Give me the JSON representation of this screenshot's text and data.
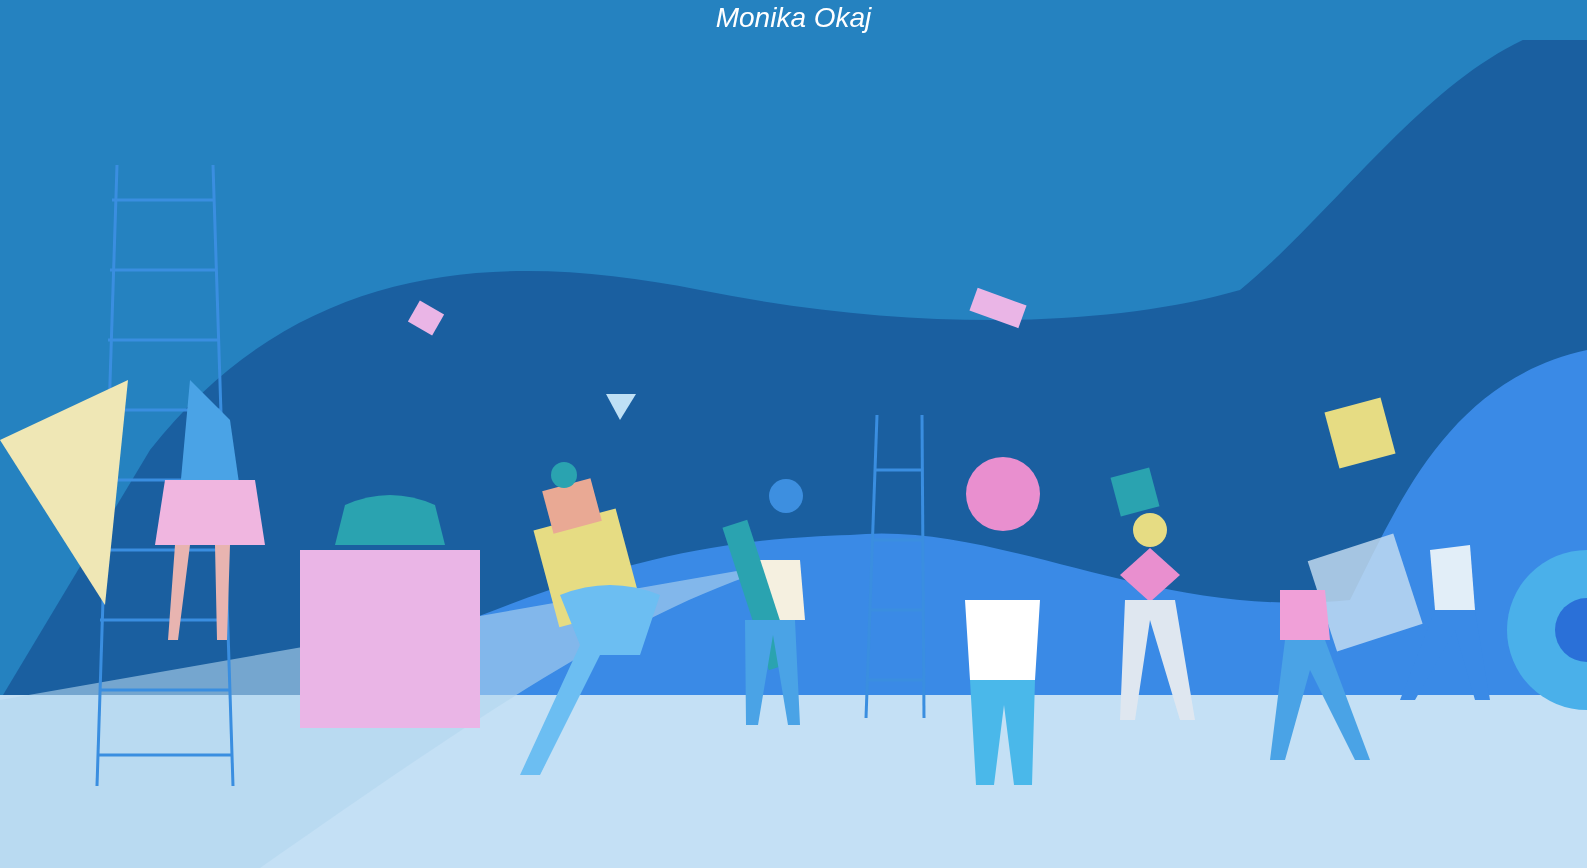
{
  "header": {
    "author": "Monika Okaj"
  }
}
